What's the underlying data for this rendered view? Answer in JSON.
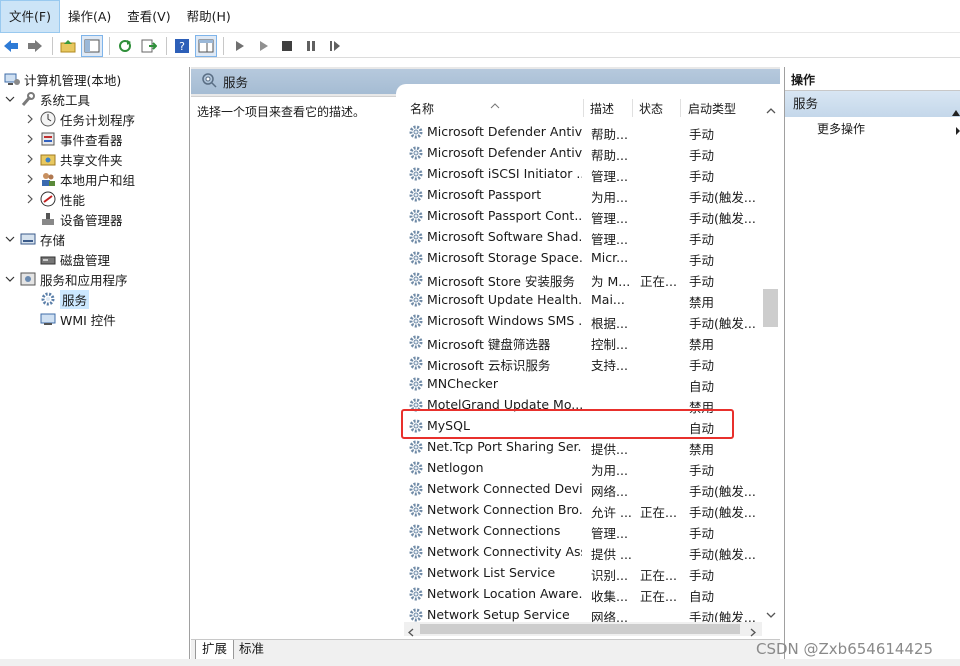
{
  "menu": [
    "文件(F)",
    "操作(A)",
    "查看(V)",
    "帮助(H)"
  ],
  "tree": {
    "root": "计算机管理(本地)",
    "system_tools": "系统工具",
    "task_scheduler": "任务计划程序",
    "event_viewer": "事件查看器",
    "shared_folders": "共享文件夹",
    "local_users": "本地用户和组",
    "performance": "性能",
    "device_manager": "设备管理器",
    "storage": "存储",
    "disk_management": "磁盘管理",
    "services_apps": "服务和应用程序",
    "services": "服务",
    "wmi": "WMI 控件"
  },
  "center": {
    "title": "服务",
    "description": "选择一个项目来查看它的描述。",
    "columns": {
      "name": "名称",
      "desc": "描述",
      "state": "状态",
      "start": "启动类型"
    },
    "rows": [
      {
        "name": "Microsoft Defender Antiv...",
        "desc": "帮助...",
        "state": "",
        "start": "手动"
      },
      {
        "name": "Microsoft Defender Antiv...",
        "desc": "帮助...",
        "state": "",
        "start": "手动"
      },
      {
        "name": "Microsoft iSCSI Initiator ...",
        "desc": "管理...",
        "state": "",
        "start": "手动"
      },
      {
        "name": "Microsoft Passport",
        "desc": "为用...",
        "state": "",
        "start": "手动(触发..."
      },
      {
        "name": "Microsoft Passport Cont...",
        "desc": "管理...",
        "state": "",
        "start": "手动(触发..."
      },
      {
        "name": "Microsoft Software Shad...",
        "desc": "管理...",
        "state": "",
        "start": "手动"
      },
      {
        "name": "Microsoft Storage Space...",
        "desc": "Micr...",
        "state": "",
        "start": "手动"
      },
      {
        "name": "Microsoft Store 安装服务",
        "desc": "为 M...",
        "state": "正在...",
        "start": "手动"
      },
      {
        "name": "Microsoft Update Health...",
        "desc": "Mai...",
        "state": "",
        "start": "禁用"
      },
      {
        "name": "Microsoft Windows SMS ...",
        "desc": "根据...",
        "state": "",
        "start": "手动(触发..."
      },
      {
        "name": "Microsoft 键盘筛选器",
        "desc": "控制...",
        "state": "",
        "start": "禁用"
      },
      {
        "name": "Microsoft 云标识服务",
        "desc": "支持...",
        "state": "",
        "start": "手动"
      },
      {
        "name": "MNChecker",
        "desc": "",
        "state": "",
        "start": "自动"
      },
      {
        "name": "MotelGrand Update Mo...",
        "desc": "",
        "state": "",
        "start": "禁用"
      },
      {
        "name": "MySQL",
        "desc": "",
        "state": "",
        "start": "自动"
      },
      {
        "name": "Net.Tcp Port Sharing Ser...",
        "desc": "提供...",
        "state": "",
        "start": "禁用"
      },
      {
        "name": "Netlogon",
        "desc": "为用...",
        "state": "",
        "start": "手动"
      },
      {
        "name": "Network Connected Devi...",
        "desc": "网络...",
        "state": "",
        "start": "手动(触发..."
      },
      {
        "name": "Network Connection Bro...",
        "desc": "允许 ...",
        "state": "正在...",
        "start": "手动(触发..."
      },
      {
        "name": "Network Connections",
        "desc": "管理...",
        "state": "",
        "start": "手动"
      },
      {
        "name": "Network Connectivity Ass...",
        "desc": "提供 ...",
        "state": "",
        "start": "手动(触发..."
      },
      {
        "name": "Network List Service",
        "desc": "识别...",
        "state": "正在...",
        "start": "手动"
      },
      {
        "name": "Network Location Aware...",
        "desc": "收集...",
        "state": "正在...",
        "start": "自动"
      },
      {
        "name": "Network Setup Service",
        "desc": "网络...",
        "state": "",
        "start": "手动(触发..."
      }
    ],
    "tabs": [
      "扩展",
      "标准"
    ]
  },
  "actions": {
    "title": "操作",
    "group": "服务",
    "more": "更多操作"
  },
  "watermark": "CSDN @Zxb654614425",
  "colors": {
    "highlight": "#e8302c",
    "selection": "#cce8ff",
    "header": "#b6c9dd"
  }
}
